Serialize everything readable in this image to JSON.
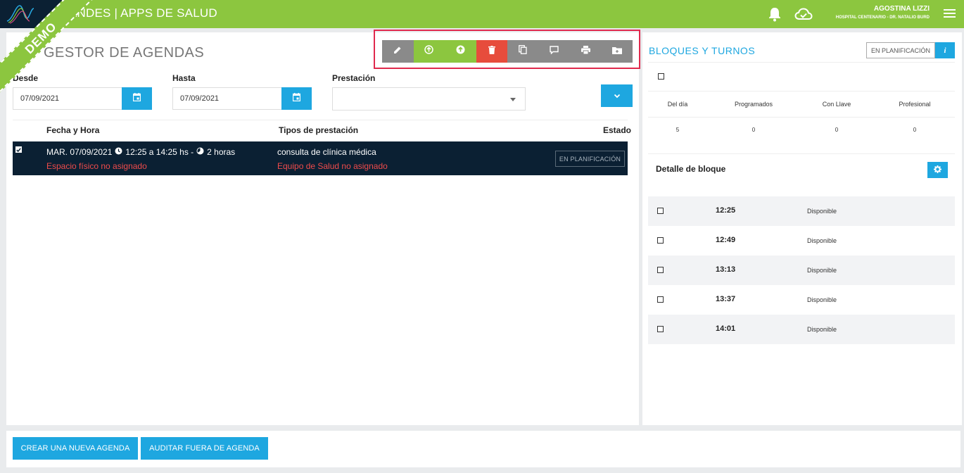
{
  "header": {
    "app_title": "ANDES | APPS DE SALUD",
    "user_name": "AGOSTINA LIZZI",
    "user_org": "HOSPITAL CENTENARIO - DR. NATALIO BURD"
  },
  "demo_label": "DEMO",
  "page": {
    "title": "GESTOR DE AGENDAS"
  },
  "toolbar": {
    "buttons": [
      "edit-icon",
      "upload-circle-icon",
      "arrow-circle-icon",
      "trash-icon",
      "copy-icon",
      "comment-icon",
      "print-icon",
      "folder-icon"
    ]
  },
  "filters": {
    "desde_label": "Desde",
    "desde_value": "07/09/2021",
    "hasta_label": "Hasta",
    "hasta_value": "07/09/2021",
    "prestacion_label": "Prestación",
    "prestacion_value": ""
  },
  "table": {
    "headers": [
      "Fecha y Hora",
      "Tipos de prestación",
      "Estado"
    ],
    "rows": [
      {
        "date": "MAR. 07/09/2021",
        "time": "12:25 a 14:25 hs -",
        "duration": "2 horas",
        "warning_space": "Espacio físico no asignado",
        "prestacion": "consulta de clínica médica",
        "warning_team": "Equipo de Salud no asignado",
        "estado": "EN PLANIFICACIÓN"
      }
    ]
  },
  "right_panel": {
    "title": "BLOQUES Y TURNOS",
    "estado": "EN PLANIFICACIÓN",
    "info_label": "i",
    "stats_headers": [
      "Del día",
      "Programados",
      "Con Llave",
      "Profesional"
    ],
    "stats_values": [
      "5",
      "0",
      "0",
      "0"
    ],
    "detalle_title": "Detalle de bloque",
    "slots": [
      {
        "time": "12:25",
        "status": "Disponible"
      },
      {
        "time": "12:49",
        "status": "Disponible"
      },
      {
        "time": "13:13",
        "status": "Disponible"
      },
      {
        "time": "13:37",
        "status": "Disponible"
      },
      {
        "time": "14:01",
        "status": "Disponible"
      }
    ]
  },
  "footer": {
    "crear_label": "CREAR UNA NUEVA AGENDA",
    "auditar_label": "AUDITAR FUERA DE AGENDA"
  },
  "colors": {
    "brand_green": "#8cc63f",
    "accent_blue": "#1ea7e0",
    "dark_navy": "#0b2033",
    "danger_red": "#e74c3c",
    "highlight_frame": "#e0294d"
  }
}
